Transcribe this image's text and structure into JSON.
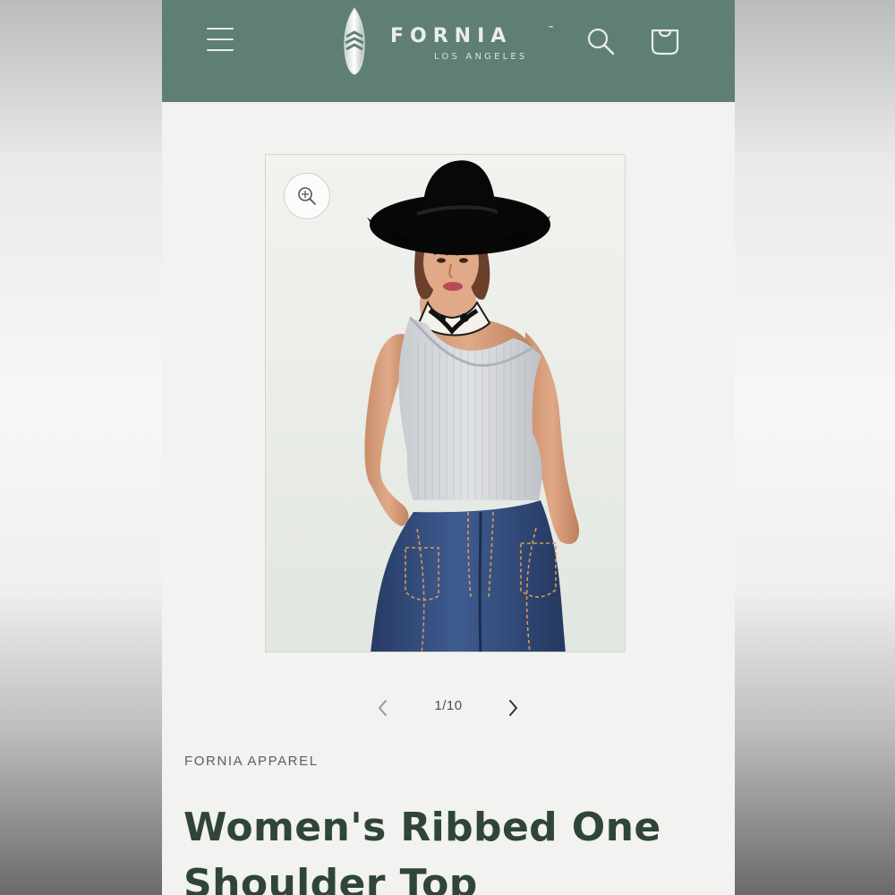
{
  "brand": {
    "name": "FORNIA",
    "trademark": "™",
    "subtitle": "LOS ANGELES"
  },
  "header": {
    "menu_icon": "hamburger-menu-icon",
    "search_icon": "search-icon",
    "cart_icon": "shopping-bag-icon",
    "background_color": "#5f7f73"
  },
  "gallery": {
    "zoom_icon": "zoom-in-icon",
    "current_page": 1,
    "total_pages": 10,
    "counter_text": "1/10",
    "prev_icon": "chevron-left-icon",
    "next_icon": "chevron-right-icon"
  },
  "product": {
    "vendor": "FORNIA APPAREL",
    "title": "Women's Ribbed One Shoulder Top",
    "title_color": "#2f4637"
  }
}
